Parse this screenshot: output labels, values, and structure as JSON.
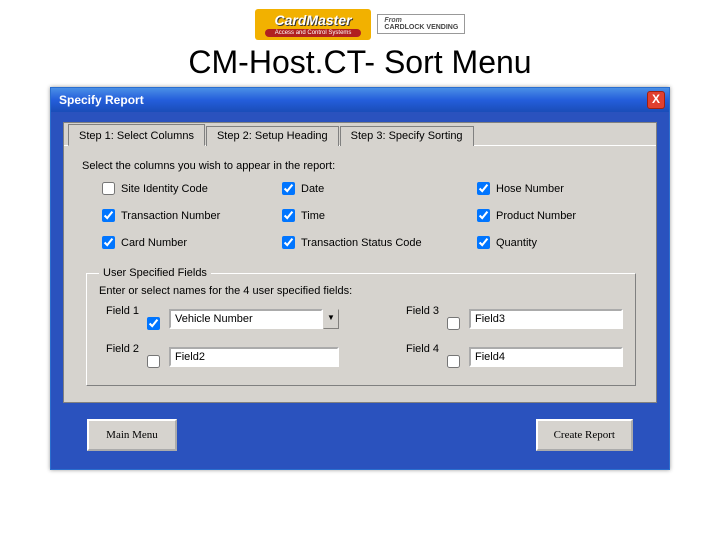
{
  "logo": {
    "cardmaster": "CardMaster",
    "cardmaster_sub": "Access and Control Systems",
    "from": "From",
    "cardlock": "CARDLOCK VENDING"
  },
  "page_title": "CM-Host.CT- Sort Menu",
  "window": {
    "title": "Specify Report",
    "close": "X"
  },
  "tabs": {
    "t1": "Step 1: Select Columns",
    "t2": "Step 2: Setup Heading",
    "t3": "Step 3: Specify Sorting"
  },
  "prompt": "Select the columns you wish to appear in the report:",
  "checks": {
    "site_identity": "Site Identity Code",
    "date": "Date",
    "hose": "Hose Number",
    "txn_no": "Transaction Number",
    "time": "Time",
    "product": "Product Number",
    "card": "Card Number",
    "txn_status": "Transaction Status Code",
    "qty": "Quantity"
  },
  "user_fields": {
    "legend": "User Specified Fields",
    "prompt": "Enter or select names for the 4 user specified fields:",
    "f1_label": "Field 1",
    "f1_value": "Vehicle Number",
    "f2_label": "Field 2",
    "f2_value": "Field2",
    "f3_label": "Field 3",
    "f3_value": "Field3",
    "f4_label": "Field 4",
    "f4_value": "Field4"
  },
  "buttons": {
    "main_menu": "Main Menu",
    "create_report": "Create Report"
  }
}
